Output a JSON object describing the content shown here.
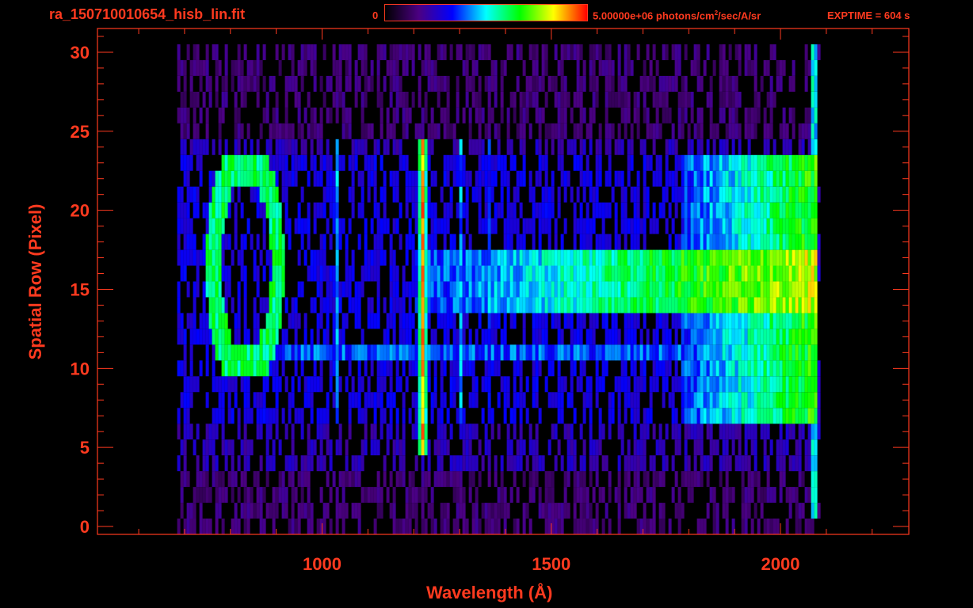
{
  "header": {
    "file_name": "ra_150710010654_hisb_lin.fit",
    "colorbar_min_label": "0",
    "colorbar_max_value": "5.00000e+06 photons/cm",
    "colorbar_max_exp": "2",
    "colorbar_max_unit": "/sec/A/sr",
    "exptime": "EXPTIME = 604 s"
  },
  "colors": {
    "axis": "#ff3a1f",
    "background": "#000000",
    "colormap": [
      "#000000",
      "#4b0082",
      "#0000ff",
      "#00ffff",
      "#00ff00",
      "#ffff00",
      "#ff0000"
    ]
  },
  "chart_data": {
    "type": "heatmap",
    "title": "ra_150710010654_hisb_lin.fit",
    "xlabel": "Wavelength (Å)",
    "ylabel": "Spatial Row (Pixel)",
    "xlim": [
      510,
      2280
    ],
    "ylim": [
      -0.5,
      31.5
    ],
    "xticks": [
      1000,
      1500,
      2000
    ],
    "yticks": [
      0,
      5,
      10,
      15,
      20,
      25,
      30
    ],
    "colorbar": {
      "min": 0,
      "max": 5000000,
      "unit": "photons/cm2/sec/A/sr"
    },
    "grid": false,
    "rows": 31,
    "data_extent_wavelength": [
      680,
      2075
    ],
    "features": [
      {
        "name": "Lyman-alpha",
        "wavelength": 1216,
        "rows": [
          5,
          24
        ],
        "level": 0.9
      },
      {
        "name": "bright stripe",
        "wavelength_range": [
          1200,
          2075
        ],
        "rows": [
          14,
          17
        ],
        "level": 0.55
      },
      {
        "name": "ring",
        "wavelength_range": [
          760,
          920
        ],
        "rows": [
          10,
          23
        ],
        "level": 0.6
      },
      {
        "name": "band",
        "wavelength": 1030,
        "rows": [
          7,
          24
        ],
        "level": 0.45
      },
      {
        "name": "band",
        "wavelength": 1300,
        "rows": [
          7,
          24
        ],
        "level": 0.45
      },
      {
        "name": "band",
        "wavelength": 1360,
        "rows": [
          7,
          24
        ],
        "level": 0.35
      },
      {
        "name": "red edge",
        "wavelength": 2070,
        "rows": [
          1,
          30
        ],
        "level": 0.7
      }
    ]
  }
}
